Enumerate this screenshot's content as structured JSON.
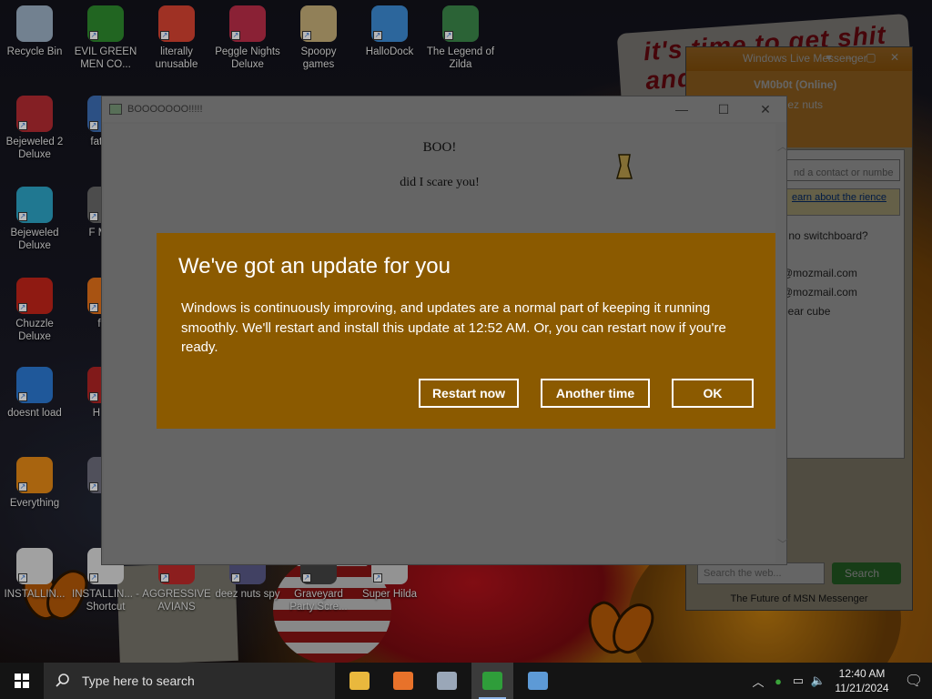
{
  "desktop": {
    "icons": [
      {
        "label": "Recycle Bin",
        "color": "#9fb3c8"
      },
      {
        "label": "EVIL GREEN MEN CO...",
        "color": "#2f8d2f"
      },
      {
        "label": "literally unusable",
        "color": "#dd4433"
      },
      {
        "label": "Peggle Nights Deluxe",
        "color": "#c02f4a"
      },
      {
        "label": "Spoopy games",
        "color": "#c9b27a"
      },
      {
        "label": "HalloDock",
        "color": "#3e8ed8"
      },
      {
        "label": "The Legend of Zilda",
        "color": "#3c8a4b"
      },
      {
        "label": "Bejeweled 2 Deluxe",
        "color": "#b82b33"
      },
      {
        "label": "fat like",
        "color": "#3e6fb7"
      },
      {
        "label": "Bejeweled Deluxe",
        "color": "#2da7c9"
      },
      {
        "label": "F MON",
        "color": "#6a6a6a"
      },
      {
        "label": "Chuzzle Deluxe",
        "color": "#c6241a"
      },
      {
        "label": "furr",
        "color": "#e9731a"
      },
      {
        "label": "doesnt load",
        "color": "#2b7ad6"
      },
      {
        "label": "H We",
        "color": "#b32424"
      },
      {
        "label": "Everything",
        "color": "#e98b15"
      },
      {
        "label": "is",
        "color": "#6f6f7f"
      },
      {
        "label": "INSTALLIN...",
        "color": "#e0e0e0"
      },
      {
        "label": "INSTALLIN... - Shortcut",
        "color": "#e0e0e0"
      },
      {
        "label": "AGGRESSIVE AVIANS",
        "color": "#c32a2a"
      },
      {
        "label": "deez nuts spy",
        "color": "#5a5a8a"
      },
      {
        "label": "Graveyard Party Scre...",
        "color": "#444444"
      },
      {
        "label": "Super Hilda",
        "color": "#cccccc"
      }
    ],
    "wallpaper_sign": "it's time to get shit and"
  },
  "msn": {
    "title": "Windows Live Messenger",
    "status_name": "VM0b0t",
    "status": "(Online)",
    "personal_message": "rate deez nuts",
    "find_placeholder": "nd a contact or numbe",
    "learn_link": "earn about the rience",
    "contacts": [
      "- no switchboard?",
      "@mozmail.com",
      "@mozmail.com",
      "bear cube"
    ],
    "search_placeholder": "Search the web...",
    "search_button": "Search",
    "footer": "The Future of MSN Messenger"
  },
  "boo_window": {
    "title": "BOOOOOOO!!!!!",
    "heading": "BOO!",
    "text": "did I scare you!"
  },
  "update_dialog": {
    "heading": "We've got an update for you",
    "message": "Windows is continuously improving, and updates are a normal part of keeping it running smoothly. We'll restart and install this update at 12:52 AM. Or, you can restart now if you're ready.",
    "buttons": {
      "restart": "Restart now",
      "another": "Another time",
      "ok": "OK"
    }
  },
  "taskbar": {
    "search_placeholder": "Type here to search",
    "apps": [
      {
        "name": "file-explorer",
        "color": "#e9b83d"
      },
      {
        "name": "firefox",
        "color": "#e8722a"
      },
      {
        "name": "app-window",
        "color": "#9aa7b8"
      },
      {
        "name": "messenger",
        "color": "#2f9d3a"
      },
      {
        "name": "notepad",
        "color": "#5d9ad6"
      }
    ],
    "clock_time": "12:40 AM",
    "clock_date": "11/21/2024"
  }
}
